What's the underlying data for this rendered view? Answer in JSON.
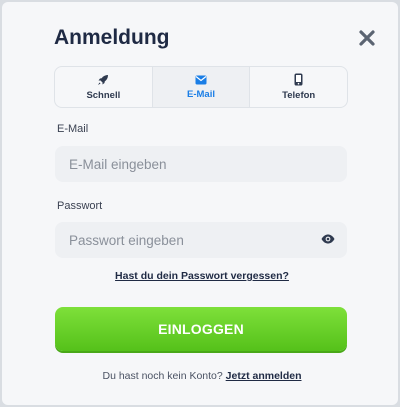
{
  "dialog": {
    "title": "Anmeldung"
  },
  "tabs": [
    {
      "label": "Schnell",
      "icon": "rocket-icon",
      "active": false
    },
    {
      "label": "E-Mail",
      "icon": "envelope-icon",
      "active": true
    },
    {
      "label": "Telefon",
      "icon": "phone-icon",
      "active": false
    }
  ],
  "email": {
    "label": "E-Mail",
    "placeholder": "E-Mail eingeben",
    "value": ""
  },
  "password": {
    "label": "Passwort",
    "placeholder": "Passwort eingeben",
    "value": ""
  },
  "forgot_link": "Hast du dein Passwort vergessen?",
  "login_button": "EINLOGGEN",
  "register": {
    "text": "Du hast noch kein Konto?",
    "link": "Jetzt anmelden"
  },
  "colors": {
    "accent_tab": "#1a7ee6",
    "button_green": "#62cc22",
    "heading": "#1f2a44"
  }
}
